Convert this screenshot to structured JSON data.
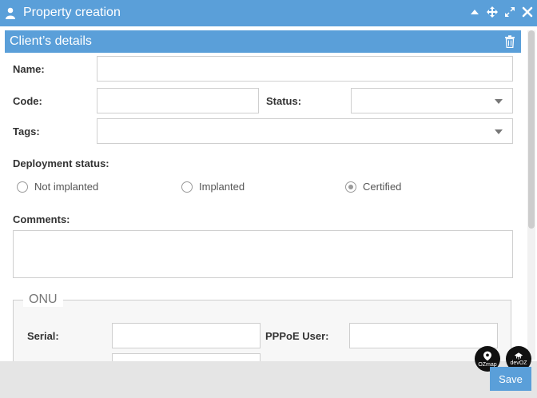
{
  "window": {
    "title": "Property creation",
    "controls": [
      "arrow-up-icon",
      "move-icon",
      "expand-icon",
      "close-icon"
    ]
  },
  "section": {
    "title": "Client’s details"
  },
  "form": {
    "name_label": "Name:",
    "name_value": "",
    "code_label": "Code:",
    "code_value": "",
    "status_label": "Status:",
    "status_value": "",
    "tags_label": "Tags:",
    "tags_value": "",
    "deployment_label": "Deployment status:",
    "deployment_options": [
      "Not implanted",
      "Implanted",
      "Certified"
    ],
    "deployment_selected": "Certified",
    "comments_label": "Comments:",
    "comments_value": ""
  },
  "onu": {
    "legend": "ONU",
    "serial_label": "Serial:",
    "serial_value": "",
    "pppoe_label": "PPPoE User:",
    "pppoe_value": ""
  },
  "badges": {
    "ozmap": "OZmap",
    "devoz": "devOZ"
  },
  "footer": {
    "save_label": "Save"
  },
  "colors": {
    "accent": "#5a9fd9",
    "footer": "#e5e5e5"
  }
}
